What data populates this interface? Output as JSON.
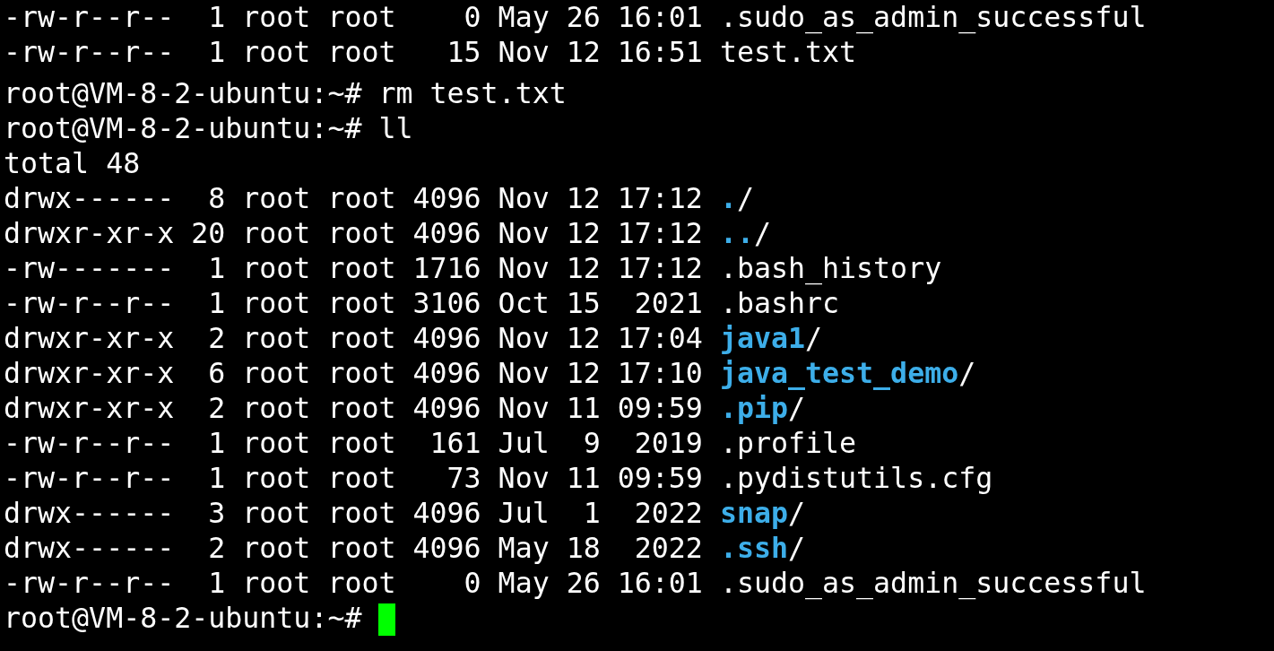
{
  "lines": [
    {
      "kind": "entry",
      "details": "-rw-r--r--  1 root root    0 May 26 16:01",
      "name": ".sudo_as_admin_successful",
      "directory": false
    },
    {
      "kind": "entry",
      "details": "-rw-r--r--  1 root root   15 Nov 12 16:51",
      "name": "test.txt",
      "directory": false
    },
    {
      "kind": "prompt",
      "prompt": "root@VM-8-2-ubuntu:~#",
      "command": "rm test.txt"
    },
    {
      "kind": "prompt",
      "prompt": "root@VM-8-2-ubuntu:~#",
      "command": "ll"
    },
    {
      "kind": "output",
      "text": "total 48"
    },
    {
      "kind": "entry",
      "details": "drwx------  8 root root 4096 Nov 12 17:12",
      "name": ".",
      "suffix": "/",
      "directory": true
    },
    {
      "kind": "entry",
      "details": "drwxr-xr-x 20 root root 4096 Nov 12 17:12",
      "name": "..",
      "suffix": "/",
      "directory": true
    },
    {
      "kind": "entry",
      "details": "-rw-------  1 root root 1716 Nov 12 17:12",
      "name": ".bash_history",
      "directory": false
    },
    {
      "kind": "entry",
      "details": "-rw-r--r--  1 root root 3106 Oct 15  2021",
      "name": ".bashrc",
      "directory": false
    },
    {
      "kind": "entry",
      "details": "drwxr-xr-x  2 root root 4096 Nov 12 17:04",
      "name": "java1",
      "suffix": "/",
      "directory": true
    },
    {
      "kind": "entry",
      "details": "drwxr-xr-x  6 root root 4096 Nov 12 17:10",
      "name": "java_test_demo",
      "suffix": "/",
      "directory": true
    },
    {
      "kind": "entry",
      "details": "drwxr-xr-x  2 root root 4096 Nov 11 09:59",
      "name": ".pip",
      "suffix": "/",
      "directory": true
    },
    {
      "kind": "entry",
      "details": "-rw-r--r--  1 root root  161 Jul  9  2019",
      "name": ".profile",
      "directory": false
    },
    {
      "kind": "entry",
      "details": "-rw-r--r--  1 root root   73 Nov 11 09:59",
      "name": ".pydistutils.cfg",
      "directory": false
    },
    {
      "kind": "entry",
      "details": "drwx------  3 root root 4096 Jul  1  2022",
      "name": "snap",
      "suffix": "/",
      "directory": true
    },
    {
      "kind": "entry",
      "details": "drwx------  2 root root 4096 May 18  2022",
      "name": ".ssh",
      "suffix": "/",
      "directory": true
    },
    {
      "kind": "entry",
      "details": "-rw-r--r--  1 root root    0 May 26 16:01",
      "name": ".sudo_as_admin_successful",
      "directory": false
    },
    {
      "kind": "prompt",
      "prompt": "root@VM-8-2-ubuntu:~#",
      "cursor": true
    }
  ]
}
